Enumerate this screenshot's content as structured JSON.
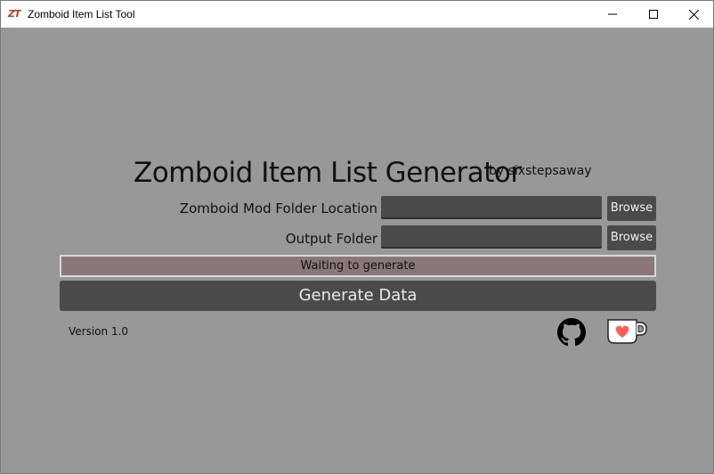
{
  "window": {
    "icon_text": "ZT",
    "title": "Zomboid Item List Tool"
  },
  "header": {
    "title": "Zomboid Item List Generator",
    "byline": "by sixstepsaway"
  },
  "form": {
    "mod_folder_label": "Zomboid Mod Folder Location",
    "mod_folder_value": "",
    "output_folder_label": "Output Folder",
    "output_folder_value": "",
    "browse_label": "Browse"
  },
  "status": {
    "text": "Waiting to generate",
    "color": "#8a7878"
  },
  "actions": {
    "generate_label": "Generate Data"
  },
  "footer": {
    "version": "Version 1.0",
    "github_icon": "github-icon",
    "kofi_icon": "kofi-cup-heart-icon"
  },
  "colors": {
    "background": "#989898",
    "control": "#4a4a4a",
    "heart": "#ff5e5b"
  }
}
